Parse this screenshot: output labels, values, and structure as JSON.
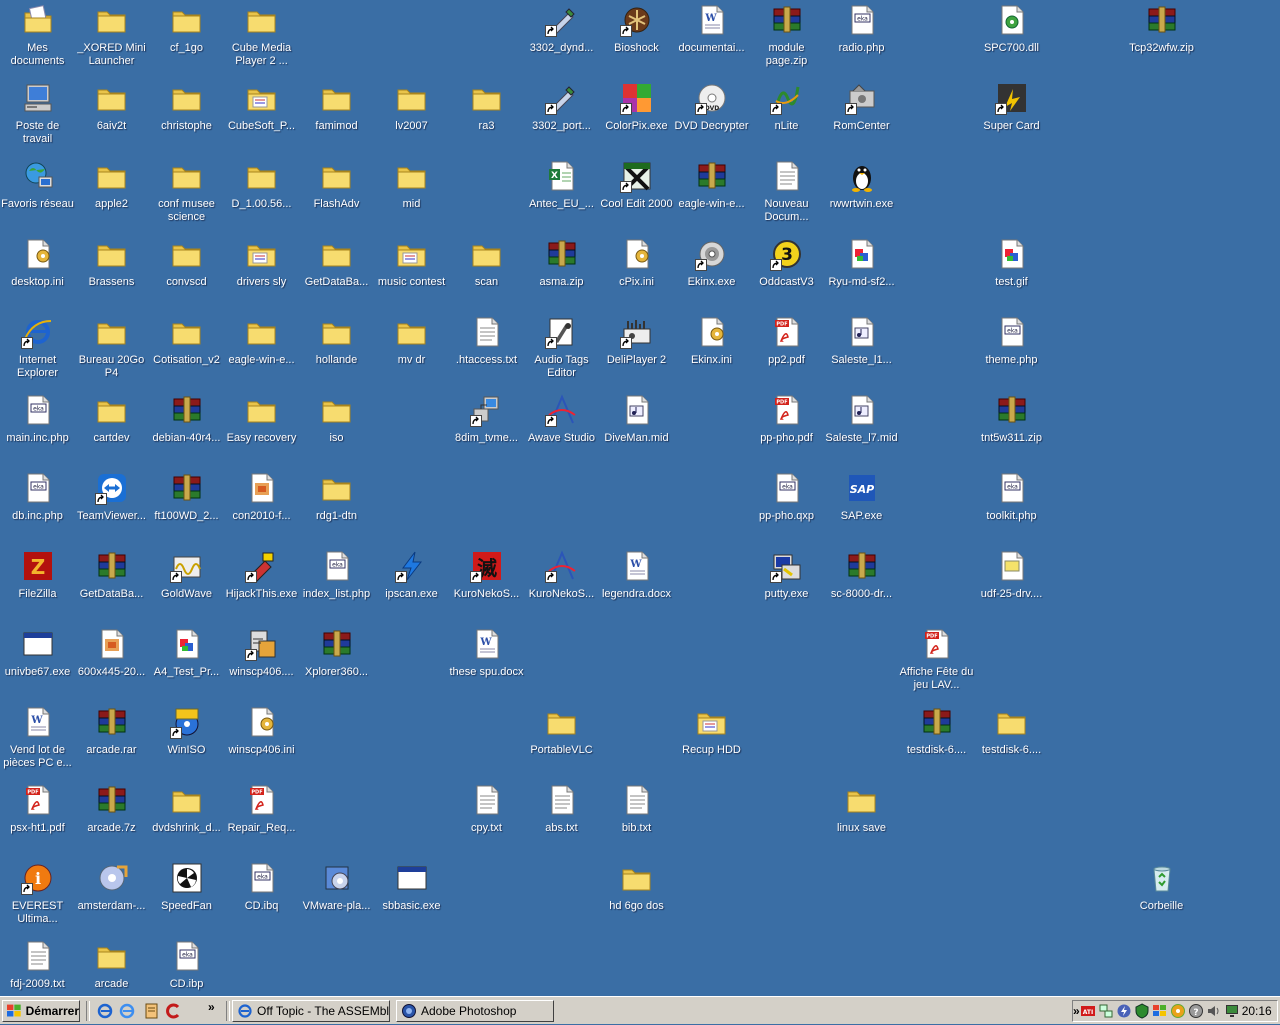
{
  "desktop": {
    "icons": [
      {
        "label": "Mes documents",
        "icon": "my-documents-icon"
      },
      {
        "label": "_XORED Mini Launcher",
        "icon": "folder-icon"
      },
      {
        "label": "cf_1go",
        "icon": "folder-icon"
      },
      {
        "label": "Cube Media Player 2 ...",
        "icon": "folder-icon"
      },
      {
        "label": "3302_dynd...",
        "icon": "shortcut-app-icon"
      },
      {
        "label": "Bioshock",
        "icon": "bioshock-icon"
      },
      {
        "label": "documentai...",
        "icon": "word-doc-icon"
      },
      {
        "label": "module page.zip",
        "icon": "winrar-archive-icon"
      },
      {
        "label": "radio.php",
        "icon": "php-file-icon"
      },
      {
        "label": "SPC700.dll",
        "icon": "dll-file-icon"
      },
      {
        "label": "Tcp32wfw.zip",
        "icon": "winrar-archive-icon"
      },
      {
        "label": "Poste de travail",
        "icon": "my-computer-icon"
      },
      {
        "label": "6aiv2t",
        "icon": "folder-icon"
      },
      {
        "label": "christophe",
        "icon": "folder-icon"
      },
      {
        "label": "CubeSoft_P...",
        "icon": "shared-folder-icon"
      },
      {
        "label": "famimod",
        "icon": "folder-icon"
      },
      {
        "label": "lv2007",
        "icon": "folder-icon"
      },
      {
        "label": "ra3",
        "icon": "folder-icon"
      },
      {
        "label": "3302_port...",
        "icon": "shortcut-app-icon"
      },
      {
        "label": "ColorPix.exe",
        "icon": "colorpix-icon"
      },
      {
        "label": "DVD Decrypter",
        "icon": "dvd-icon"
      },
      {
        "label": "nLite",
        "icon": "nlite-icon"
      },
      {
        "label": "RomCenter",
        "icon": "romcenter-icon"
      },
      {
        "label": "Super Card",
        "icon": "supercard-icon"
      },
      {
        "label": "Favoris réseau",
        "icon": "network-icon"
      },
      {
        "label": "apple2",
        "icon": "folder-icon"
      },
      {
        "label": "conf musee science",
        "icon": "folder-icon"
      },
      {
        "label": "D_1.00.56...",
        "icon": "folder-icon"
      },
      {
        "label": "FlashAdv",
        "icon": "folder-icon"
      },
      {
        "label": "mid",
        "icon": "folder-icon"
      },
      {
        "label": "Antec_EU_...",
        "icon": "excel-file-icon"
      },
      {
        "label": "Cool Edit 2000",
        "icon": "cooledit-icon"
      },
      {
        "label": "eagle-win-e...",
        "icon": "winrar-archive-icon"
      },
      {
        "label": "Nouveau Docum...",
        "icon": "text-file-icon"
      },
      {
        "label": "rwwrtwin.exe",
        "icon": "tux-penguin-icon"
      },
      {
        "label": "desktop.ini",
        "icon": "ini-file-icon"
      },
      {
        "label": "Brassens",
        "icon": "folder-icon"
      },
      {
        "label": "convscd",
        "icon": "folder-icon"
      },
      {
        "label": "drivers sly",
        "icon": "shared-folder-icon"
      },
      {
        "label": "GetDataBa...",
        "icon": "folder-icon"
      },
      {
        "label": "music contest",
        "icon": "shared-folder-icon"
      },
      {
        "label": "scan",
        "icon": "folder-icon"
      },
      {
        "label": "asma.zip",
        "icon": "winrar-archive-icon"
      },
      {
        "label": "cPix.ini",
        "icon": "ini-file-icon"
      },
      {
        "label": "Ekinx.exe",
        "icon": "cd-icon"
      },
      {
        "label": "OddcastV3",
        "icon": "oddcast-icon"
      },
      {
        "label": "Ryu-md-sf2...",
        "icon": "image-file-icon"
      },
      {
        "label": "test.gif",
        "icon": "image-file-icon"
      },
      {
        "label": "Internet Explorer",
        "icon": "internet-explorer-icon"
      },
      {
        "label": "Bureau 20Go P4",
        "icon": "folder-icon"
      },
      {
        "label": "Cotisation_v2",
        "icon": "folder-icon"
      },
      {
        "label": "eagle-win-e...",
        "icon": "folder-icon"
      },
      {
        "label": "hollande",
        "icon": "folder-icon"
      },
      {
        "label": "mv dr",
        "icon": "folder-icon"
      },
      {
        "label": ".htaccess.txt",
        "icon": "text-file-icon"
      },
      {
        "label": "Audio Tags Editor",
        "icon": "audiotags-icon"
      },
      {
        "label": "DeliPlayer 2",
        "icon": "deliplayer-icon"
      },
      {
        "label": "Ekinx.ini",
        "icon": "ini-file-icon"
      },
      {
        "label": "pp2.pdf",
        "icon": "pdf-file-icon"
      },
      {
        "label": "Saleste_l1...",
        "icon": "midi-file-icon"
      },
      {
        "label": "theme.php",
        "icon": "php-file-icon"
      },
      {
        "label": "main.inc.php",
        "icon": "php-file-icon"
      },
      {
        "label": "cartdev",
        "icon": "folder-icon"
      },
      {
        "label": "debian-40r4...",
        "icon": "winrar-archive-icon"
      },
      {
        "label": "Easy recovery",
        "icon": "folder-icon"
      },
      {
        "label": "iso",
        "icon": "folder-icon"
      },
      {
        "label": "8dim_tvme...",
        "icon": "network-app-icon"
      },
      {
        "label": "Awave Studio",
        "icon": "awave-icon"
      },
      {
        "label": "DiveMan.mid",
        "icon": "midi-file-icon"
      },
      {
        "label": "pp-pho.pdf",
        "icon": "pdf-file-icon"
      },
      {
        "label": "Saleste_l7.mid",
        "icon": "midi-file-icon"
      },
      {
        "label": "tnt5w311.zip",
        "icon": "winrar-archive-icon"
      },
      {
        "label": "db.inc.php",
        "icon": "php-file-icon"
      },
      {
        "label": "TeamViewer...",
        "icon": "teamviewer-icon"
      },
      {
        "label": "ft100WD_2...",
        "icon": "winrar-archive-icon"
      },
      {
        "label": "con2010-f...",
        "icon": "image-jpg-icon"
      },
      {
        "label": "rdg1-dtn",
        "icon": "folder-icon"
      },
      {
        "label": "pp-pho.qxp",
        "icon": "php-file-icon"
      },
      {
        "label": "SAP.exe",
        "icon": "sap-icon"
      },
      {
        "label": "toolkit.php",
        "icon": "php-file-icon"
      },
      {
        "label": "FileZilla",
        "icon": "filezilla-icon"
      },
      {
        "label": "GetDataBa...",
        "icon": "winrar-archive-icon"
      },
      {
        "label": "GoldWave",
        "icon": "goldwave-icon"
      },
      {
        "label": "HijackThis.exe",
        "icon": "hijackthis-icon"
      },
      {
        "label": "index_list.php",
        "icon": "php-file-icon"
      },
      {
        "label": "ipscan.exe",
        "icon": "ipscan-icon"
      },
      {
        "label": "KuroNekoS...",
        "icon": "kuroneko-icon"
      },
      {
        "label": "KuroNekoS...",
        "icon": "awave-icon"
      },
      {
        "label": "legendra.docx",
        "icon": "word-doc-icon"
      },
      {
        "label": "putty.exe",
        "icon": "putty-icon"
      },
      {
        "label": "sc-8000-dr...",
        "icon": "winrar-archive-icon"
      },
      {
        "label": "udf-25-drv....",
        "icon": "udf-file-icon"
      },
      {
        "label": "univbe67.exe",
        "icon": "window-exe-icon"
      },
      {
        "label": "600x445-20...",
        "icon": "image-jpg-icon"
      },
      {
        "label": "A4_Test_Pr...",
        "icon": "image-file-icon"
      },
      {
        "label": "winscp406....",
        "icon": "winscp-icon"
      },
      {
        "label": "Xplorer360...",
        "icon": "winrar-archive-icon"
      },
      {
        "label": "these spu.docx",
        "icon": "word-doc-icon"
      },
      {
        "label": "Affiche Fête du jeu LAV...",
        "icon": "pdf-file-icon"
      },
      {
        "label": "Vend lot de pièces PC e...",
        "icon": "word-doc-icon"
      },
      {
        "label": "arcade.rar",
        "icon": "winrar-archive-icon"
      },
      {
        "label": "WinISO",
        "icon": "winiso-icon"
      },
      {
        "label": "winscp406.ini",
        "icon": "ini-file-icon"
      },
      {
        "label": "PortableVLC",
        "icon": "folder-icon"
      },
      {
        "label": "Recup HDD",
        "icon": "shared-folder-icon"
      },
      {
        "label": "testdisk-6....",
        "icon": "winrar-archive-icon"
      },
      {
        "label": "testdisk-6....",
        "icon": "folder-icon"
      },
      {
        "label": "psx-ht1.pdf",
        "icon": "pdf-file-icon"
      },
      {
        "label": "arcade.7z",
        "icon": "winrar-archive-icon"
      },
      {
        "label": "dvdshrink_d...",
        "icon": "folder-icon"
      },
      {
        "label": "Repair_Req...",
        "icon": "pdf-file-icon"
      },
      {
        "label": "cpy.txt",
        "icon": "text-file-icon"
      },
      {
        "label": "abs.txt",
        "icon": "text-file-icon"
      },
      {
        "label": "bib.txt",
        "icon": "text-file-icon"
      },
      {
        "label": "linux save",
        "icon": "folder-icon"
      },
      {
        "label": "EVEREST Ultima...",
        "icon": "everest-icon"
      },
      {
        "label": "amsterdam-...",
        "icon": "media-file-icon"
      },
      {
        "label": "SpeedFan",
        "icon": "speedfan-icon"
      },
      {
        "label": "CD.ibq",
        "icon": "php-file-icon"
      },
      {
        "label": "VMware-pla...",
        "icon": "vmware-icon"
      },
      {
        "label": "sbbasic.exe",
        "icon": "window-exe-icon"
      },
      {
        "label": "hd 6go dos",
        "icon": "folder-icon"
      },
      {
        "label": "Corbeille",
        "icon": "recycle-bin-icon"
      },
      {
        "label": "fdj-2009.txt",
        "icon": "text-file-icon"
      },
      {
        "label": "arcade",
        "icon": "folder-icon"
      },
      {
        "label": "CD.ibp",
        "icon": "php-file-icon"
      }
    ]
  },
  "taskbar": {
    "start_label": "Démarrer",
    "quick_launch": [
      "internet-explorer-icon",
      "ie-alt-icon",
      "notepad-icon",
      "ccleaner-icon"
    ],
    "tasks": [
      {
        "label": "Off Topic - The ASSEMbl...",
        "icon": "internet-explorer-icon"
      },
      {
        "label": "Adobe Photoshop",
        "icon": "photoshop-icon"
      }
    ],
    "tray_icons": [
      "ati-icon",
      "network-tray-icon",
      "flash-icon",
      "security-icon",
      "windows-flag-icon",
      "media-icon",
      "help-icon",
      "volume-icon",
      "monitor-icon"
    ],
    "clock": "20:16"
  }
}
